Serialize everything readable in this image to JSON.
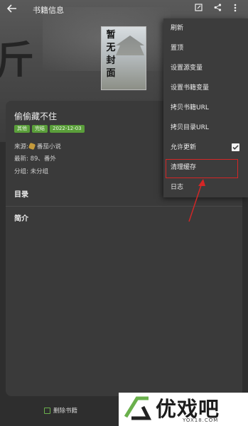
{
  "appbar": {
    "title": "书籍信息",
    "icons": [
      "back-arrow-icon",
      "edit-icon",
      "share-icon",
      "more-vert-icon"
    ]
  },
  "background": {
    "big_char": "斤"
  },
  "cover": {
    "text_lines": [
      "暂",
      "无",
      "封",
      "面"
    ]
  },
  "book": {
    "title": "偷偷藏不住",
    "tags": [
      "其他",
      "完结",
      "2022-12-03"
    ],
    "tag_color": "#5a9e3a",
    "source_label": "来源:",
    "source_value": "番茄小说",
    "latest": "最新: 89、番外",
    "group": "分组: 未分组"
  },
  "sections": {
    "toc": "目录",
    "intro": "简介"
  },
  "bottom": {
    "delete_label": "删除书籍"
  },
  "menu": {
    "items": [
      {
        "label": "刷新"
      },
      {
        "label": "置顶"
      },
      {
        "label": "设置源变量"
      },
      {
        "label": "设置书籍变量"
      },
      {
        "label": "拷贝书籍URL"
      },
      {
        "label": "拷贝目录URL"
      },
      {
        "label": "允许更新",
        "checked": true
      },
      {
        "label": "清理缓存"
      },
      {
        "label": "日志"
      }
    ]
  },
  "annotation": {
    "color": "#d62626",
    "highlighted_item": "清理缓存"
  },
  "watermark": {
    "text": "优戏吧",
    "url": "YOX18.COM"
  }
}
